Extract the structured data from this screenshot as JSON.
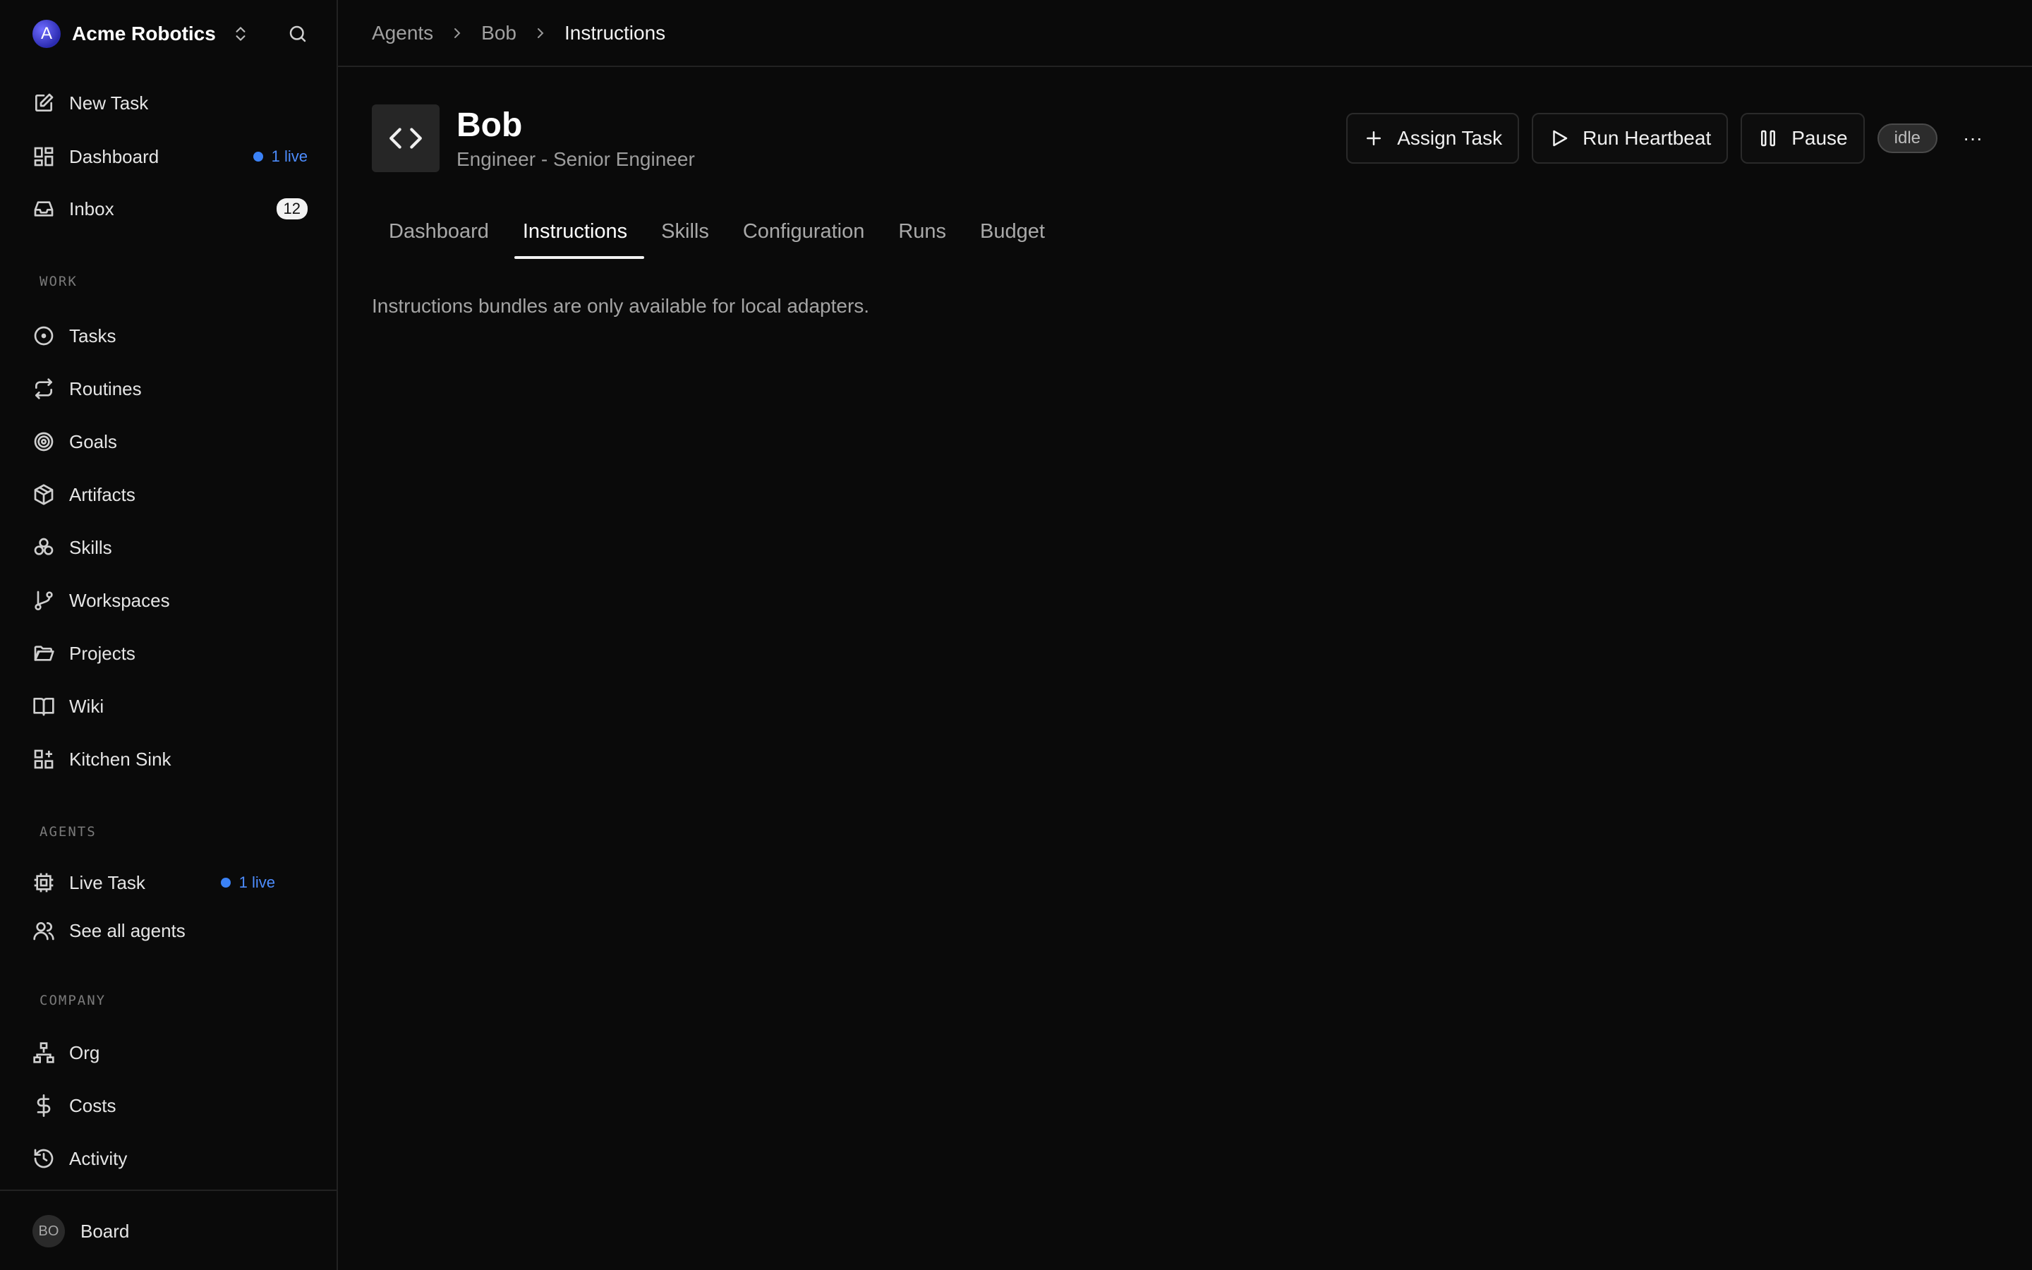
{
  "sidebar": {
    "company": {
      "logo_letter": "A",
      "name": "Acme Robotics"
    },
    "primary": [
      {
        "label": "New Task",
        "icon": "edit-icon"
      },
      {
        "label": "Dashboard",
        "icon": "dashboard-icon",
        "live": "1 live"
      },
      {
        "label": "Inbox",
        "icon": "inbox-icon",
        "count": "12"
      }
    ],
    "work_label": "WORK",
    "work": [
      {
        "label": "Tasks",
        "icon": "circle-dot-icon"
      },
      {
        "label": "Routines",
        "icon": "repeat-icon"
      },
      {
        "label": "Goals",
        "icon": "target-icon"
      },
      {
        "label": "Artifacts",
        "icon": "package-icon"
      },
      {
        "label": "Skills",
        "icon": "boxes-icon"
      },
      {
        "label": "Workspaces",
        "icon": "git-branch-icon"
      },
      {
        "label": "Projects",
        "icon": "folder-icon"
      },
      {
        "label": "Wiki",
        "icon": "book-icon"
      },
      {
        "label": "Kitchen Sink",
        "icon": "grid-plus-icon"
      }
    ],
    "agents_label": "AGENTS",
    "agents": [
      {
        "label": "Live Task",
        "icon": "cpu-icon",
        "live": "1 live"
      },
      {
        "label": "See all agents",
        "icon": "users-icon"
      }
    ],
    "company_label": "COMPANY",
    "company_items": [
      {
        "label": "Org",
        "icon": "org-chart-icon"
      },
      {
        "label": "Costs",
        "icon": "dollar-icon"
      },
      {
        "label": "Activity",
        "icon": "history-icon"
      }
    ],
    "footer": {
      "avatar": "BO",
      "label": "Board"
    }
  },
  "breadcrumb": [
    "Agents",
    "Bob",
    "Instructions"
  ],
  "agent": {
    "name": "Bob",
    "role": "Engineer - Senior Engineer",
    "status": "idle"
  },
  "actions": {
    "assign": "Assign Task",
    "heartbeat": "Run Heartbeat",
    "pause": "Pause",
    "more": "···"
  },
  "tabs": [
    "Dashboard",
    "Instructions",
    "Skills",
    "Configuration",
    "Runs",
    "Budget"
  ],
  "active_tab": "Instructions",
  "content": {
    "notice": "Instructions bundles are only available for local adapters."
  },
  "colors": {
    "background": "#0a0a0a",
    "accent_live": "#3b82f6",
    "border": "#222222"
  }
}
